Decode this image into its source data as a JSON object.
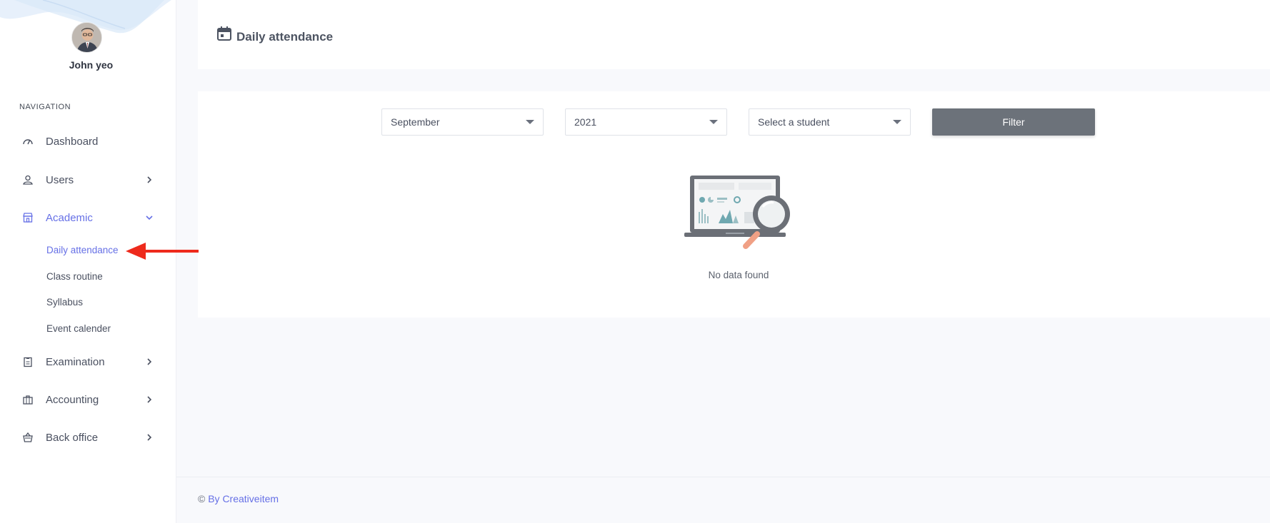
{
  "user": {
    "name": "John yeo"
  },
  "nav": {
    "title": "NAVIGATION",
    "items": [
      {
        "label": "Dashboard",
        "icon": "gauge-icon"
      },
      {
        "label": "Users",
        "icon": "user-icon"
      },
      {
        "label": "Academic",
        "icon": "school-icon",
        "active": true
      },
      {
        "label": "Examination",
        "icon": "clipboard-icon"
      },
      {
        "label": "Accounting",
        "icon": "briefcase-icon"
      },
      {
        "label": "Back office",
        "icon": "basket-icon"
      }
    ],
    "academic_sub": [
      {
        "label": "Daily attendance",
        "active": true
      },
      {
        "label": "Class routine"
      },
      {
        "label": "Syllabus"
      },
      {
        "label": "Event calender"
      }
    ]
  },
  "header": {
    "title": "Daily attendance",
    "icon": "calendar-icon"
  },
  "filters": {
    "month": "September",
    "year": "2021",
    "student_placeholder": "Select a student",
    "button_label": "Filter"
  },
  "empty_state": {
    "message": "No data found"
  },
  "footer": {
    "copyright": "©",
    "link_text": "By Creativeitem"
  },
  "colors": {
    "accent": "#6670e6",
    "button": "#6c727a",
    "arrow": "#ee2a1c",
    "background": "#f8f9fc"
  }
}
